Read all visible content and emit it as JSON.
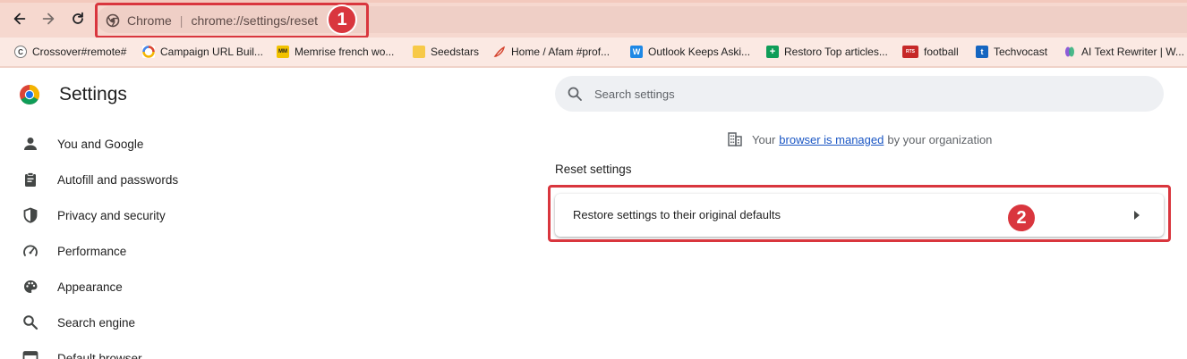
{
  "toolbar": {
    "site_label": "Chrome",
    "url": "chrome://settings/reset"
  },
  "annotations": {
    "badge_1": "1",
    "badge_2": "2",
    "callout_color": "#d9363e"
  },
  "bookmarks": [
    {
      "label": "Crossover#remote#",
      "icon": "c-circle-icon"
    },
    {
      "label": "Campaign URL Buil...",
      "icon": "google-analytics-icon"
    },
    {
      "label": "Memrise french wo...",
      "icon": "memrise-icon"
    },
    {
      "label": "Seedstars",
      "icon": "folder-icon"
    },
    {
      "label": "Home / Afam #prof...",
      "icon": "feather-icon"
    },
    {
      "label": "Outlook Keeps Aski...",
      "icon": "w-icon"
    },
    {
      "label": "Restoro Top articles...",
      "icon": "sheets-icon"
    },
    {
      "label": "football",
      "icon": "rts-icon"
    },
    {
      "label": "Techvocast",
      "icon": "t-icon"
    },
    {
      "label": "AI Text Rewriter | W...",
      "icon": "ai-rewriter-icon"
    }
  ],
  "settings": {
    "title": "Settings",
    "search_placeholder": "Search settings",
    "sidebar": [
      {
        "label": "You and Google",
        "icon": "person-icon"
      },
      {
        "label": "Autofill and passwords",
        "icon": "clipboard-icon"
      },
      {
        "label": "Privacy and security",
        "icon": "shield-icon"
      },
      {
        "label": "Performance",
        "icon": "speedometer-icon"
      },
      {
        "label": "Appearance",
        "icon": "palette-icon"
      },
      {
        "label": "Search engine",
        "icon": "magnifier-icon"
      },
      {
        "label": "Default browser",
        "icon": "browser-window-icon"
      }
    ],
    "managed": {
      "prefix": "Your",
      "link": "browser is managed",
      "suffix": "by your organization"
    },
    "section_title": "Reset settings",
    "restore_label": "Restore settings to their original defaults"
  }
}
